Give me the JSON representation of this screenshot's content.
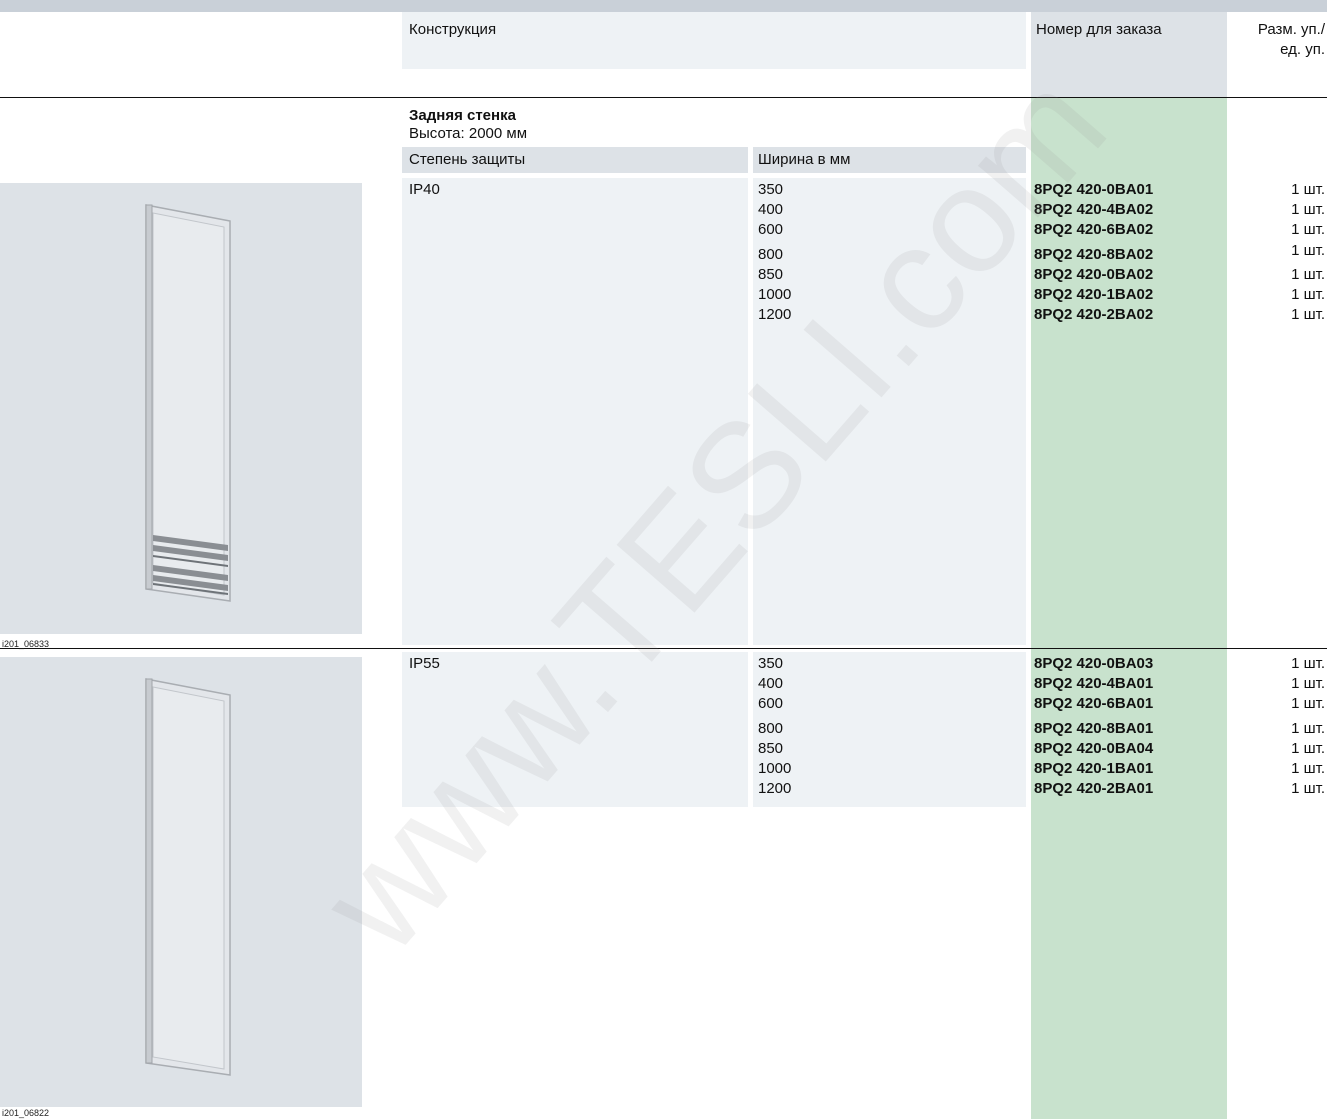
{
  "header": {
    "construction": "Конструкция",
    "order_number": "Номер для заказа",
    "pack_size_line1": "Разм. уп./",
    "pack_size_line2": "ед. уп."
  },
  "section": {
    "title": "Задняя стенка",
    "subtitle": "Высота: 2000 мм",
    "col_protection": "Степень защиты",
    "col_width": "Ширина в мм"
  },
  "groups": [
    {
      "protection": "IP40",
      "image_caption": "i201_06833",
      "rows": [
        {
          "width": "350",
          "order": "8PQ2 420-0BA01",
          "qty": "1 шт."
        },
        {
          "width": "400",
          "order": "8PQ2 420-4BA02",
          "qty": "1 шт."
        },
        {
          "width": "600",
          "order": "8PQ2 420-6BA02",
          "qty": "1 шт."
        },
        {
          "width": "800",
          "order": "8PQ2 420-8BA02",
          "qty": "1 шт."
        },
        {
          "width": "850",
          "order": "8PQ2 420-0BA02",
          "qty": "1 шт."
        },
        {
          "width": "1000",
          "order": "8PQ2 420-1BA02",
          "qty": "1 шт."
        },
        {
          "width": "1200",
          "order": "8PQ2 420-2BA02",
          "qty": "1 шт."
        }
      ]
    },
    {
      "protection": "IP55",
      "image_caption": "i201_06822",
      "rows": [
        {
          "width": "350",
          "order": "8PQ2 420-0BA03",
          "qty": "1 шт."
        },
        {
          "width": "400",
          "order": "8PQ2 420-4BA01",
          "qty": "1 шт."
        },
        {
          "width": "600",
          "order": "8PQ2 420-6BA01",
          "qty": "1 шт."
        },
        {
          "width": "800",
          "order": "8PQ2 420-8BA01",
          "qty": "1 шт."
        },
        {
          "width": "850",
          "order": "8PQ2 420-0BA04",
          "qty": "1 шт."
        },
        {
          "width": "1000",
          "order": "8PQ2 420-1BA01",
          "qty": "1 шт."
        },
        {
          "width": "1200",
          "order": "8PQ2 420-2BA01",
          "qty": "1 шт."
        }
      ]
    }
  ],
  "watermark": "www.TESLI.com",
  "colors": {
    "order_column": "#c8e2cd",
    "panel": "#eef2f5",
    "header_shade": "#dde2e7"
  }
}
